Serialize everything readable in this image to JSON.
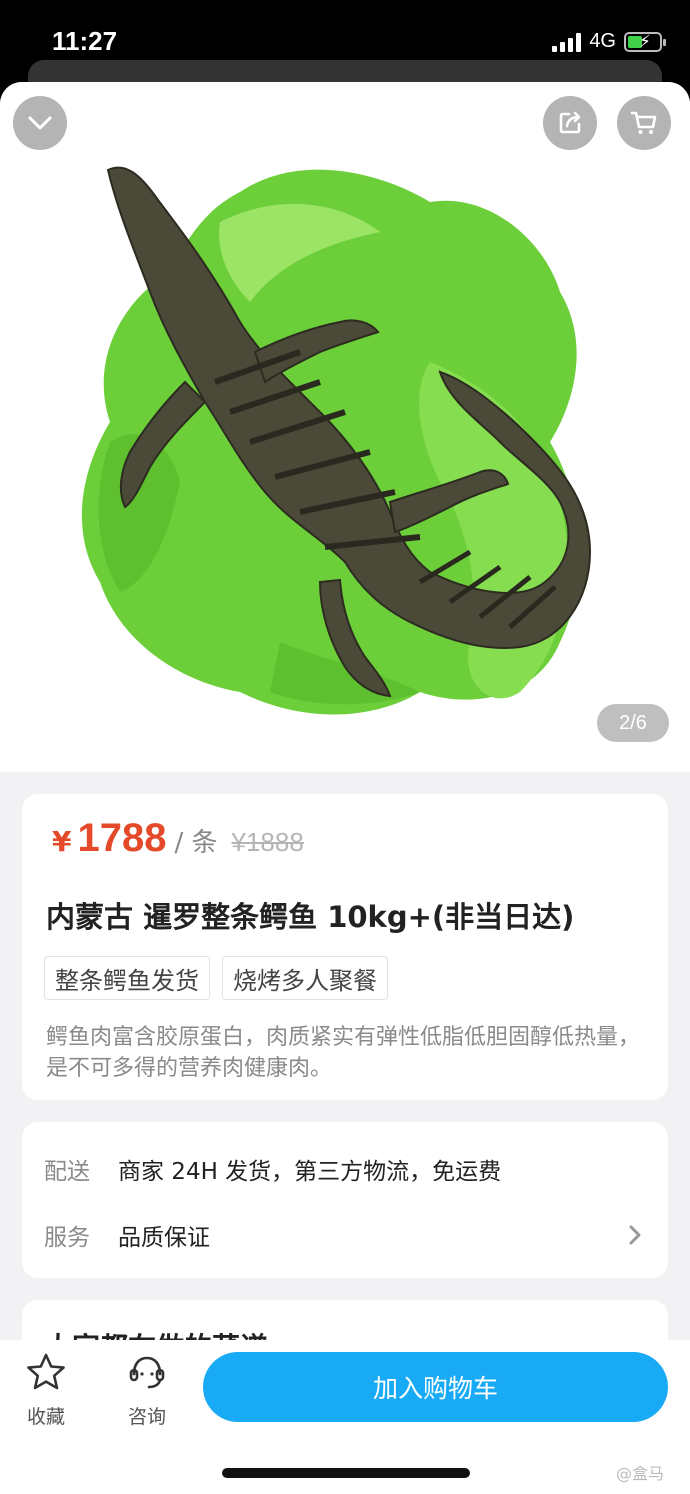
{
  "status_bar": {
    "time": "11:27",
    "network": "4G"
  },
  "gallery": {
    "indicator": "2/6"
  },
  "product": {
    "currency": "¥",
    "price": "1788",
    "unit": "/ 条",
    "original_price": "¥1888",
    "title": "内蒙古 暹罗整条鳄鱼 10kg+(非当日达)",
    "tags": [
      "整条鳄鱼发货",
      "烧烤多人聚餐"
    ],
    "description": "鳄鱼肉富含胶原蛋白，肉质紧实有弹性低脂低胆固醇低热量，是不可多得的营养肉健康肉。"
  },
  "delivery": {
    "label": "配送",
    "value": "商家 24H 发货，第三方物流，免运费"
  },
  "service": {
    "label": "服务",
    "value": "品质保证"
  },
  "recipes": {
    "title": "大家都在做的菜谱"
  },
  "bottom_bar": {
    "favorite_label": "收藏",
    "consult_label": "咨询",
    "add_to_cart_label": "加入购物车"
  },
  "watermark": "@盒马",
  "colors": {
    "price": "#e44a2a",
    "accent": "#19aaf5",
    "lettuce": "#6ccf3a",
    "crocodile": "#4b4a38"
  },
  "icons": [
    "chevron-down-icon",
    "share-icon",
    "cart-icon",
    "star-icon",
    "headset-icon",
    "chevron-right-icon"
  ]
}
